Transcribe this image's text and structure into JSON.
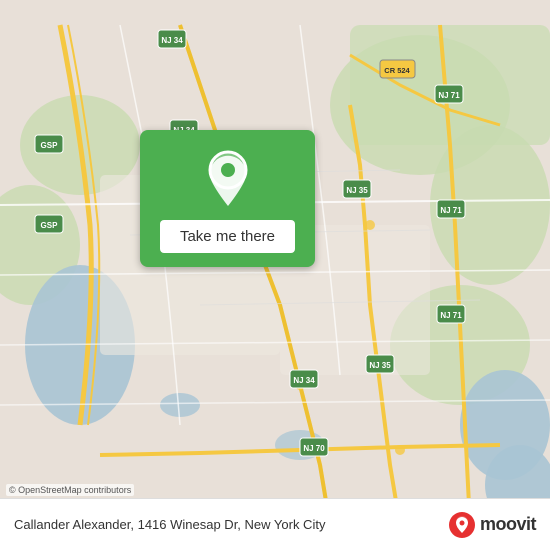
{
  "map": {
    "attribution": "© OpenStreetMap contributors"
  },
  "button": {
    "label": "Take me there"
  },
  "bottom_bar": {
    "address": "Callander Alexander, 1416 Winesap Dr, New York City",
    "logo_text": "moovit"
  },
  "road_labels": {
    "nj34_north": "NJ 34",
    "nj34_mid": "NJ 34",
    "nj34_south": "NJ 34",
    "nj71_north": "NJ 71",
    "nj71_mid": "NJ 71",
    "nj35_mid": "NJ 35",
    "nj35_south": "NJ 35",
    "nj70": "NJ 70",
    "cr524": "CR 524",
    "gsp1": "GSP",
    "gsp2": "GSP"
  }
}
